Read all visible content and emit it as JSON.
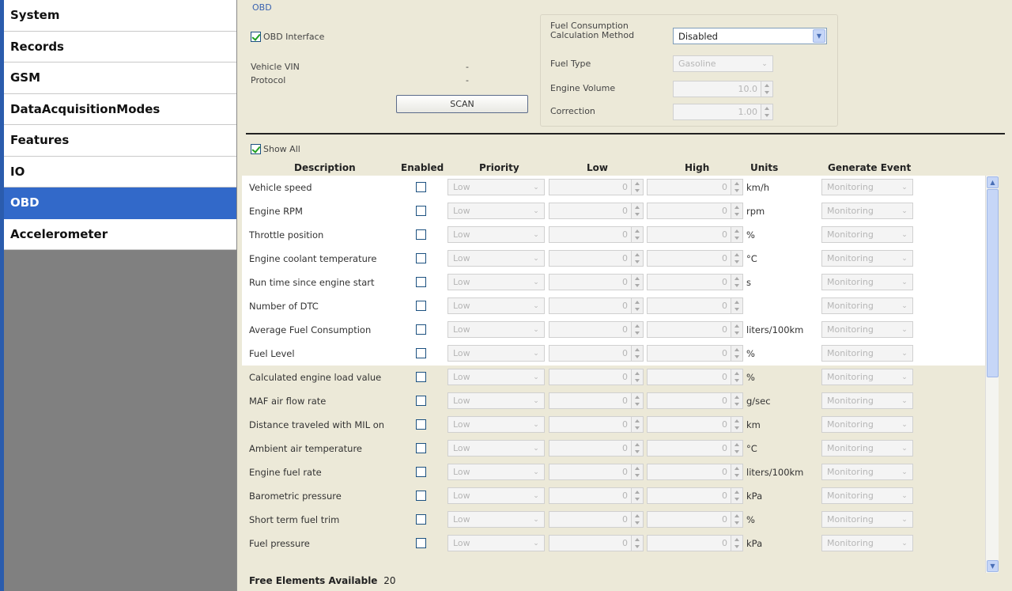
{
  "nav": {
    "items": [
      "System",
      "Records",
      "GSM",
      "DataAcquisitionModes",
      "Features",
      "IO",
      "OBD",
      "Accelerometer"
    ],
    "selected": "OBD"
  },
  "obd": {
    "group_label": "OBD",
    "interface_label": "OBD Interface",
    "interface_checked": true,
    "vin_label": "Vehicle VIN",
    "vin_value": "-",
    "protocol_label": "Protocol",
    "protocol_value": "-",
    "scan_label": "SCAN",
    "fuel_method_label": "Fuel Consumption Calculation Method",
    "fuel_method_value": "Disabled",
    "fuel_type_label": "Fuel Type",
    "fuel_type_value": "Gasoline",
    "engine_volume_label": "Engine Volume",
    "engine_volume_value": "10.0",
    "correction_label": "Correction",
    "correction_value": "1.00"
  },
  "grid": {
    "show_all_label": "Show All",
    "show_all_checked": true,
    "headers": {
      "description": "Description",
      "enabled": "Enabled",
      "priority": "Priority",
      "low": "Low",
      "high": "High",
      "units": "Units",
      "event": "Generate Event"
    },
    "priority_value": "Low",
    "low_value": "0",
    "high_value": "0",
    "event_value": "Monitoring",
    "rows": [
      {
        "desc": "Vehicle speed",
        "unit": "km/h"
      },
      {
        "desc": "Engine RPM",
        "unit": "rpm"
      },
      {
        "desc": "Throttle position",
        "unit": "%"
      },
      {
        "desc": "Engine coolant temperature",
        "unit": "°C"
      },
      {
        "desc": "Run time since engine start",
        "unit": "s"
      },
      {
        "desc": "Number of DTC",
        "unit": ""
      },
      {
        "desc": "Average Fuel Consumption",
        "unit": "liters/100km"
      },
      {
        "desc": "Fuel Level",
        "unit": "%"
      },
      {
        "desc": "Calculated engine load value",
        "unit": "%"
      },
      {
        "desc": "MAF air flow rate",
        "unit": "g/sec"
      },
      {
        "desc": "Distance traveled with MIL on",
        "unit": "km"
      },
      {
        "desc": "Ambient air temperature",
        "unit": "°C"
      },
      {
        "desc": "Engine fuel rate",
        "unit": "liters/100km"
      },
      {
        "desc": "Barometric pressure",
        "unit": "kPa"
      },
      {
        "desc": "Short term fuel trim",
        "unit": "%"
      },
      {
        "desc": "Fuel pressure",
        "unit": "kPa"
      }
    ],
    "white_rows": 8
  },
  "footer": {
    "label": "Free Elements Available",
    "value": "20"
  },
  "colors": {
    "accent": "#3269c9",
    "panel": "#ece9d8"
  }
}
